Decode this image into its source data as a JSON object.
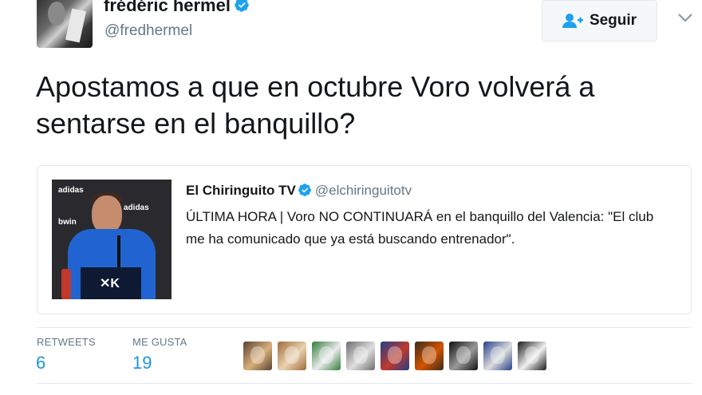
{
  "author": {
    "display_name": "frédéric hermel",
    "handle": "@fredhermel",
    "verified_icon": "verified-badge-icon"
  },
  "follow_button": {
    "label": "Seguir",
    "icon": "add-user-icon"
  },
  "menu": {
    "icon": "chevron-down-icon"
  },
  "tweet": {
    "text": "Apostamos a que en octubre Voro volverá a sentarse en el banquillo?"
  },
  "quoted_tweet": {
    "display_name": "El Chiringuito TV",
    "handle": "@elchiringuitotv",
    "text": "ÚLTIMA HORA | Voro NO CONTINUARÁ en el banquillo del Valencia: \"El club me ha comunicado que ya está buscando entrenador\".",
    "image_brand_logo": "✕K"
  },
  "stats": {
    "retweets_label": "RETWEETS",
    "retweets_value": "6",
    "likes_label": "ME GUSTA",
    "likes_value": "19"
  },
  "likers": [
    {
      "name": "liker-avatar",
      "color_a": "#5a4030",
      "color_b": "#d9b07a"
    },
    {
      "name": "liker-avatar",
      "color_a": "#a06a3a",
      "color_b": "#e8d2b0"
    },
    {
      "name": "liker-avatar",
      "color_a": "#2f7d3a",
      "color_b": "#eaeaea"
    },
    {
      "name": "liker-avatar",
      "color_a": "#6e6e6e",
      "color_b": "#dedede"
    },
    {
      "name": "liker-avatar",
      "color_a": "#1f3f8a",
      "color_b": "#c0392b"
    },
    {
      "name": "liker-avatar",
      "color_a": "#3a2a1a",
      "color_b": "#d35400"
    },
    {
      "name": "liker-avatar",
      "color_a": "#111111",
      "color_b": "#999999"
    },
    {
      "name": "liker-avatar",
      "color_a": "#27408b",
      "color_b": "#dcdcdc"
    },
    {
      "name": "liker-avatar",
      "color_a": "#1a1a1a",
      "color_b": "#f0f0f0"
    }
  ],
  "colors": {
    "link_blue": "#1b95e0",
    "verified_blue": "#1da1f2",
    "secondary_text": "#657786"
  }
}
